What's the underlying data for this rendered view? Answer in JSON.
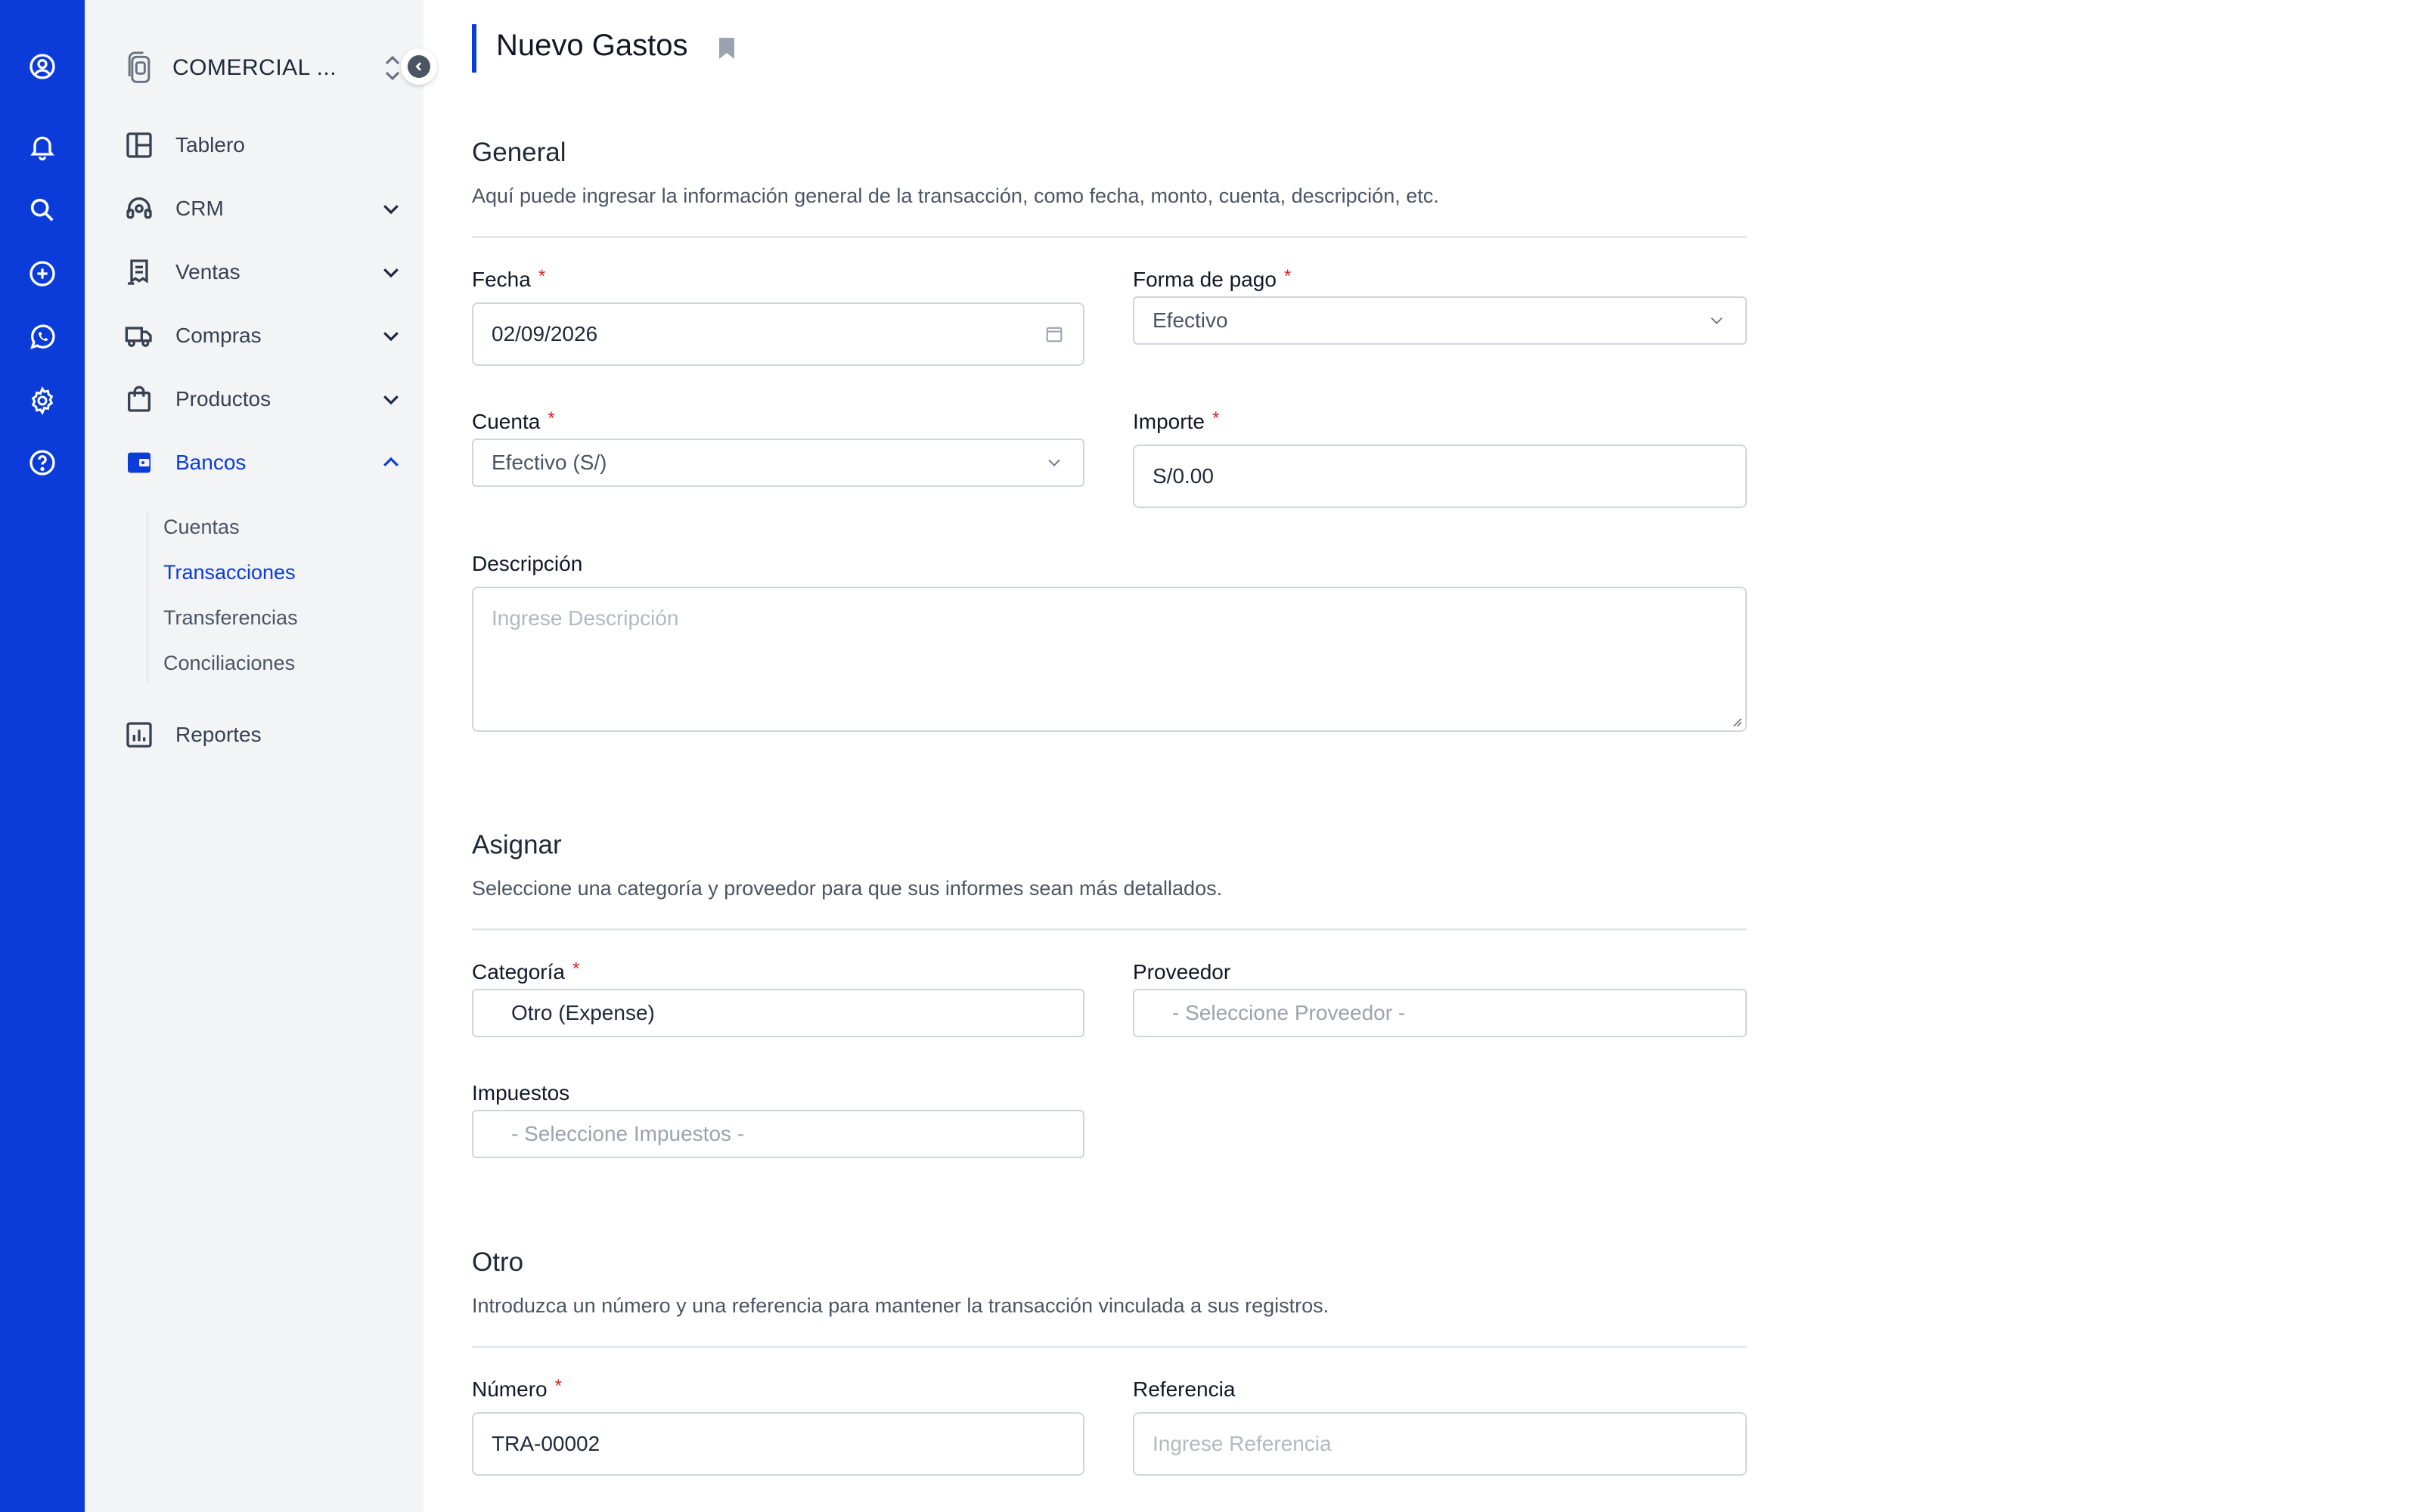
{
  "rail": {
    "icons": [
      "user-circle-icon",
      "bell-icon",
      "search-icon",
      "plus-circle-icon",
      "whatsapp-icon",
      "gear-icon",
      "help-circle-icon"
    ]
  },
  "sidebar": {
    "company_name": "COMERCIAL ...",
    "items": [
      {
        "label": "Tablero",
        "icon": "dashboard-icon"
      },
      {
        "label": "CRM",
        "icon": "headset-icon"
      },
      {
        "label": "Ventas",
        "icon": "receipt-icon"
      },
      {
        "label": "Compras",
        "icon": "truck-icon"
      },
      {
        "label": "Productos",
        "icon": "shopping-bag-icon"
      },
      {
        "label": "Bancos",
        "icon": "wallet-icon"
      },
      {
        "label": "Reportes",
        "icon": "chart-icon"
      }
    ],
    "banks_sub": [
      "Cuentas",
      "Transacciones",
      "Transferencias",
      "Conciliaciones"
    ],
    "active_sub": "Transacciones"
  },
  "page": {
    "title": "Nuevo Gastos"
  },
  "general": {
    "title": "General",
    "description": "Aquí puede ingresar la información general de la transacción, como fecha, monto, cuenta, descripción, etc.",
    "fecha_label": "Fecha",
    "fecha_value": "02/09/2026",
    "forma_pago_label": "Forma de pago",
    "forma_pago_value": "Efectivo",
    "cuenta_label": "Cuenta",
    "cuenta_value": "Efectivo (S/)",
    "importe_label": "Importe",
    "importe_value": "S/0.00",
    "descripcion_label": "Descripción",
    "descripcion_placeholder": "Ingrese Descripción"
  },
  "asignar": {
    "title": "Asignar",
    "description": "Seleccione una categoría y proveedor para que sus informes sean más detallados.",
    "categoria_label": "Categoría",
    "categoria_value": "Otro (Expense)",
    "proveedor_label": "Proveedor",
    "proveedor_placeholder": "- Seleccione Proveedor -",
    "impuestos_label": "Impuestos",
    "impuestos_placeholder": "- Seleccione Impuestos -"
  },
  "otro": {
    "title": "Otro",
    "description": "Introduzca un número y una referencia para mantener la transacción vinculada a sus registros.",
    "numero_label": "Número",
    "numero_value": "TRA-00002",
    "referencia_label": "Referencia",
    "referencia_placeholder": "Ingrese Referencia"
  },
  "colors": {
    "brand": "#0b3bd9",
    "required": "#dc2626",
    "sidebar_bg": "#f3f4f6"
  }
}
